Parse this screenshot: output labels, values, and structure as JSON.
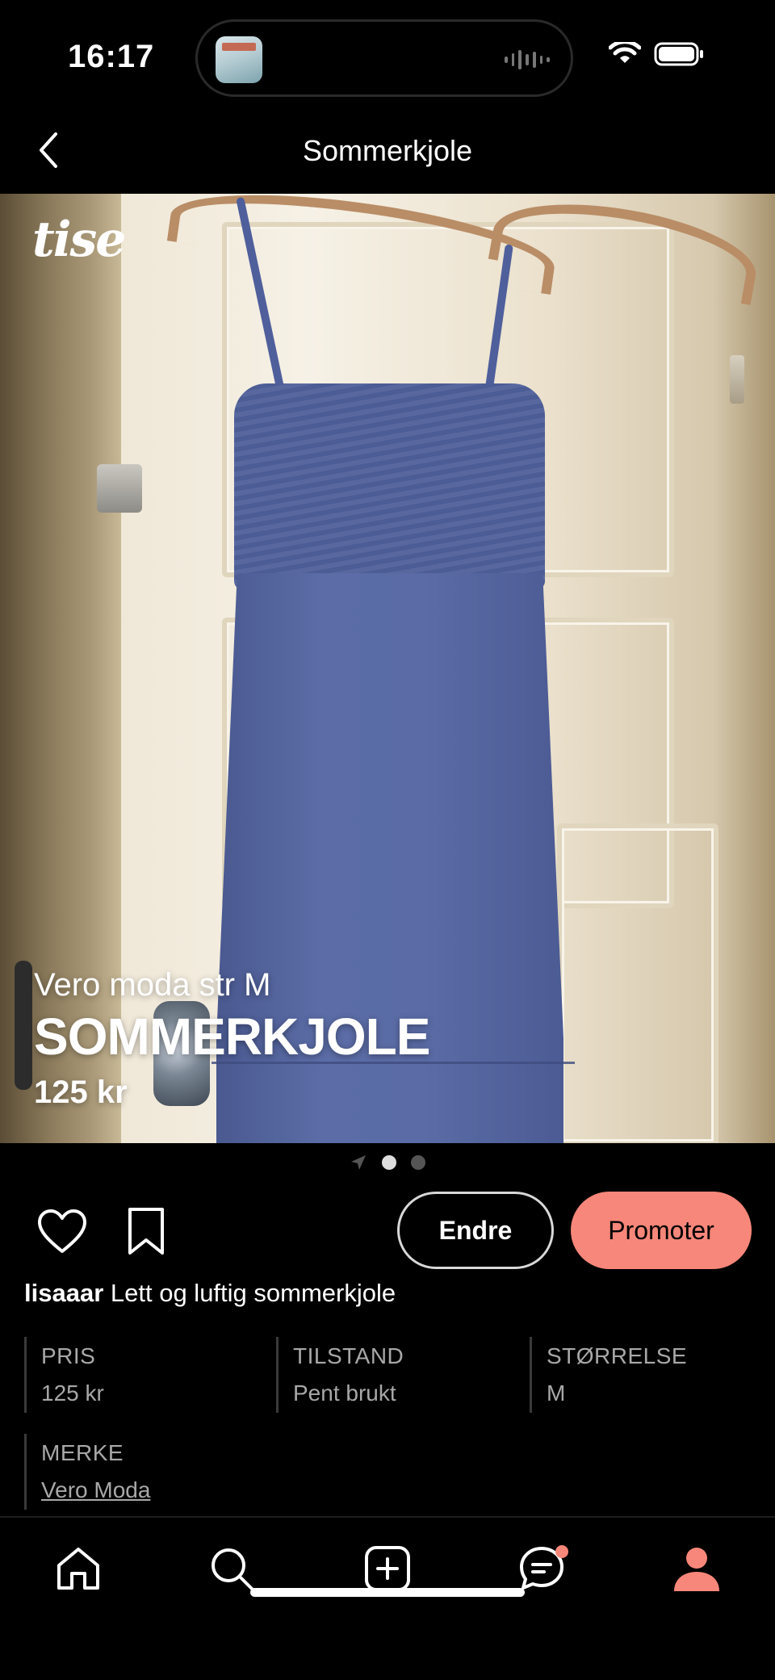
{
  "status_bar": {
    "time": "16:17"
  },
  "nav": {
    "title": "Sommerkjole"
  },
  "hero": {
    "logo": "tise",
    "subtitle": "Vero moda str M",
    "title": "SOMMERKJOLE",
    "price": "125 kr",
    "pages": 2,
    "current_page": 1
  },
  "actions": {
    "edit_label": "Endre",
    "promote_label": "Promoter"
  },
  "caption": {
    "username": "lisaaar",
    "text": "Lett og luftig sommerkjole"
  },
  "attributes": [
    {
      "label": "PRIS",
      "value": "125 kr"
    },
    {
      "label": "TILSTAND",
      "value": "Pent brukt"
    },
    {
      "label": "STØRRELSE",
      "value": "M"
    },
    {
      "label": "MERKE",
      "value": "Vero Moda"
    }
  ],
  "tabs": [
    {
      "name": "home-icon"
    },
    {
      "name": "search-icon"
    },
    {
      "name": "add-icon"
    },
    {
      "name": "messages-icon",
      "badge": true
    },
    {
      "name": "profile-icon",
      "active": true
    }
  ],
  "colors": {
    "accent": "#f7877a",
    "background": "#000000",
    "muted_text": "#a8a8a8"
  }
}
